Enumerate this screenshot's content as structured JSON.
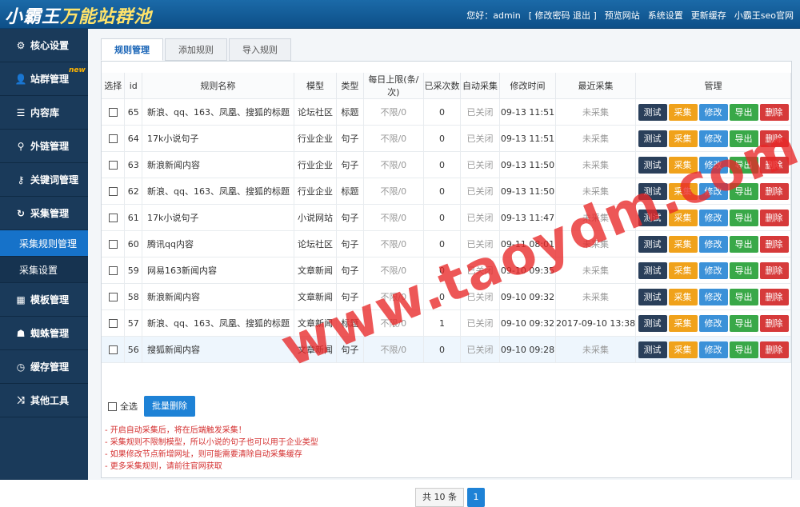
{
  "header": {
    "logo_main": "小霸王",
    "logo_sub": "万能站群池",
    "greeting": "您好：admin",
    "nav": [
      "[ 修改密码 退出 ]",
      "预览网站",
      "系统设置",
      "更新缓存",
      "小霸王seo官网"
    ]
  },
  "sidebar": {
    "items": [
      {
        "icon": "gear-icon",
        "glyph": "⚙",
        "label": "核心设置"
      },
      {
        "icon": "user-icon",
        "glyph": "👤",
        "label": "站群管理",
        "badge": "new"
      },
      {
        "icon": "document-icon",
        "glyph": "☰",
        "label": "内容库"
      },
      {
        "icon": "link-icon",
        "glyph": "⚲",
        "label": "外链管理"
      },
      {
        "icon": "key-icon",
        "glyph": "⚷",
        "label": "关键词管理"
      },
      {
        "icon": "refresh-icon",
        "glyph": "↻",
        "label": "采集管理"
      }
    ],
    "sub_items": [
      {
        "label": "采集规则管理",
        "active": true
      },
      {
        "label": "采集设置",
        "active": false
      }
    ],
    "items_after": [
      {
        "icon": "windows-icon",
        "glyph": "▦",
        "label": "模板管理"
      },
      {
        "icon": "android-icon",
        "glyph": "☗",
        "label": "蜘蛛管理"
      },
      {
        "icon": "clock-icon",
        "glyph": "◷",
        "label": "缓存管理"
      },
      {
        "icon": "shuffle-icon",
        "glyph": "⤨",
        "label": "其他工具"
      }
    ]
  },
  "tabs": [
    {
      "label": "规则管理",
      "active": true
    },
    {
      "label": "添加规则",
      "active": false
    },
    {
      "label": "导入规则",
      "active": false
    }
  ],
  "table": {
    "headers": [
      "选择",
      "id",
      "规则名称",
      "模型",
      "类型",
      "每日上限(条/次)",
      "已采次数",
      "自动采集",
      "修改时间",
      "最近采集",
      "管理"
    ],
    "action_labels": [
      "测试",
      "采集",
      "修改",
      "导出",
      "删除"
    ],
    "rows": [
      {
        "id": "65",
        "name": "新浪、qq、163、凤凰、搜狐的标题",
        "model": "论坛社区",
        "type": "标题",
        "limit": "不限/0",
        "count": "0",
        "auto": "已关闭",
        "mtime": "09-13 11:51",
        "last": "未采集"
      },
      {
        "id": "64",
        "name": "17k小说句子",
        "model": "行业企业",
        "type": "句子",
        "limit": "不限/0",
        "count": "0",
        "auto": "已关闭",
        "mtime": "09-13 11:51",
        "last": "未采集"
      },
      {
        "id": "63",
        "name": "新浪新闻内容",
        "model": "行业企业",
        "type": "句子",
        "limit": "不限/0",
        "count": "0",
        "auto": "已关闭",
        "mtime": "09-13 11:50",
        "last": "未采集"
      },
      {
        "id": "62",
        "name": "新浪、qq、163、凤凰、搜狐的标题",
        "model": "行业企业",
        "type": "标题",
        "limit": "不限/0",
        "count": "0",
        "auto": "已关闭",
        "mtime": "09-13 11:50",
        "last": "未采集"
      },
      {
        "id": "61",
        "name": "17k小说句子",
        "model": "小说网站",
        "type": "句子",
        "limit": "不限/0",
        "count": "0",
        "auto": "已关闭",
        "mtime": "09-13 11:47",
        "last": "未采集"
      },
      {
        "id": "60",
        "name": "腾讯qq内容",
        "model": "论坛社区",
        "type": "句子",
        "limit": "不限/0",
        "count": "0",
        "auto": "已关闭",
        "mtime": "09-11 08:01",
        "last": "未采集"
      },
      {
        "id": "59",
        "name": "网易163新闻内容",
        "model": "文章新闻",
        "type": "句子",
        "limit": "不限/0",
        "count": "0",
        "auto": "已关闭",
        "mtime": "09-10 09:35",
        "last": "未采集"
      },
      {
        "id": "58",
        "name": "新浪新闻内容",
        "model": "文章新闻",
        "type": "句子",
        "limit": "不限/0",
        "count": "0",
        "auto": "已关闭",
        "mtime": "09-10 09:32",
        "last": "未采集"
      },
      {
        "id": "57",
        "name": "新浪、qq、163、凤凰、搜狐的标题",
        "model": "文章新闻",
        "type": "标题",
        "limit": "不限/0",
        "count": "1",
        "auto": "已关闭",
        "mtime": "09-10 09:32",
        "last": "2017-09-10 13:38"
      },
      {
        "id": "56",
        "name": "搜狐新闻内容",
        "model": "文章新闻",
        "type": "句子",
        "limit": "不限/0",
        "count": "0",
        "auto": "已关闭",
        "mtime": "09-10 09:28",
        "last": "未采集"
      }
    ]
  },
  "bulk": {
    "select_all": "全选",
    "delete": "批量删除"
  },
  "notes": [
    "- 开启自动采集后，将在后端触发采集！",
    "- 采集规则不限制模型，所以小说的句子也可以用于企业类型",
    "- 如果修改节点新增网址，则可能需要清除自动采集缓存",
    "- 更多采集规则，请前往官网获取"
  ],
  "pager": {
    "total": "共 10 条",
    "page": "1"
  },
  "watermark": "www.taoydm.com"
}
